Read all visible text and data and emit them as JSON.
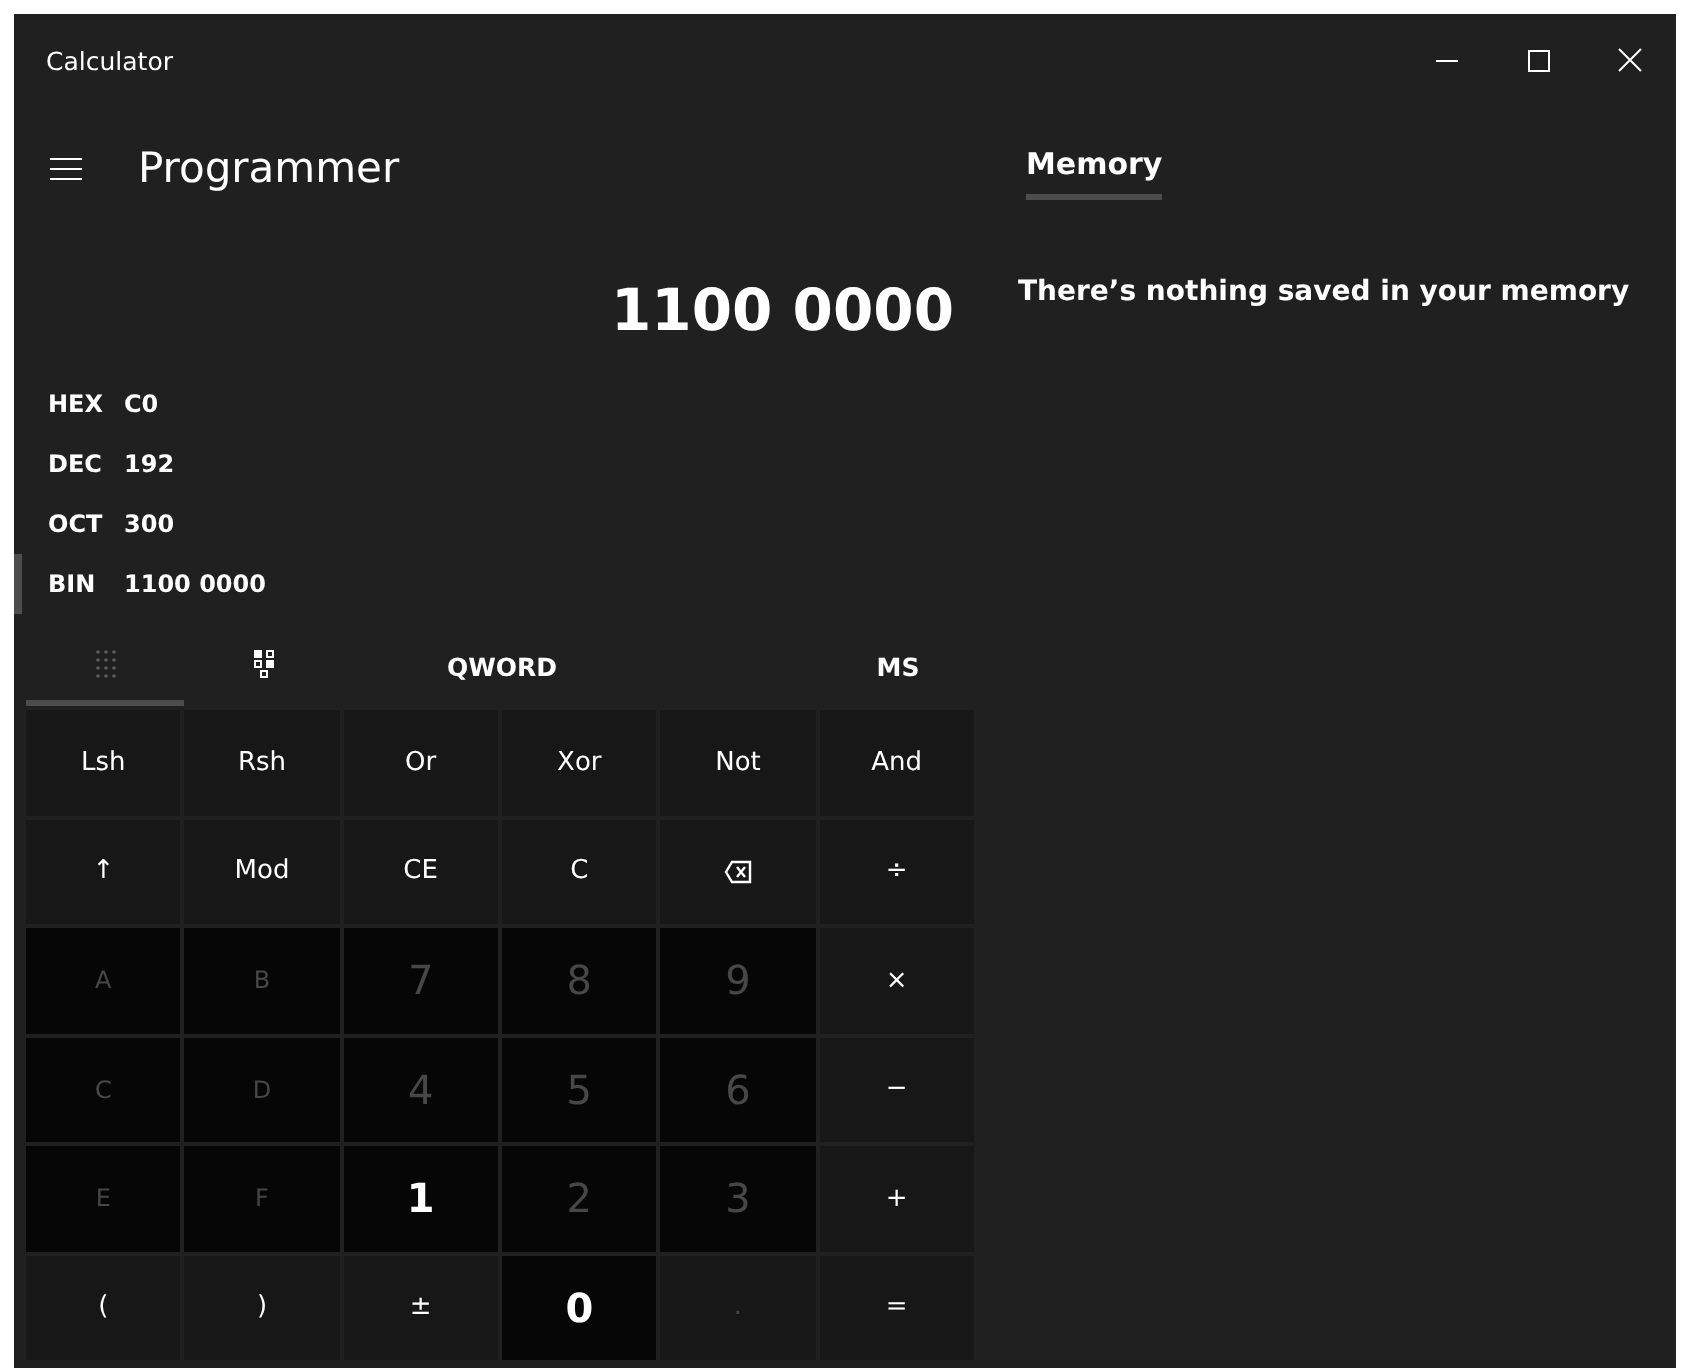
{
  "window": {
    "title": "Calculator"
  },
  "header": {
    "mode": "Programmer"
  },
  "display": {
    "value": "1100 0000"
  },
  "radix": [
    {
      "name": "HEX",
      "value": "C0",
      "selected": false
    },
    {
      "name": "DEC",
      "value": "192",
      "selected": false
    },
    {
      "name": "OCT",
      "value": "300",
      "selected": false
    },
    {
      "name": "BIN",
      "value": "1100 0000",
      "selected": true
    }
  ],
  "keypad_tabs": [
    {
      "kind": "full-keypad",
      "selected": true
    },
    {
      "kind": "bit-toggle",
      "selected": false
    }
  ],
  "word_size": "QWORD",
  "memory_store": "MS",
  "keys": [
    {
      "label": "Lsh",
      "kind": "op",
      "disabled": false
    },
    {
      "label": "Rsh",
      "kind": "op",
      "disabled": false
    },
    {
      "label": "Or",
      "kind": "op",
      "disabled": false
    },
    {
      "label": "Xor",
      "kind": "op",
      "disabled": false
    },
    {
      "label": "Not",
      "kind": "op",
      "disabled": false
    },
    {
      "label": "And",
      "kind": "op",
      "disabled": false
    },
    {
      "label": "↑",
      "kind": "op",
      "disabled": false
    },
    {
      "label": "Mod",
      "kind": "op",
      "disabled": false
    },
    {
      "label": "CE",
      "kind": "op",
      "disabled": false
    },
    {
      "label": "C",
      "kind": "op",
      "disabled": false
    },
    {
      "kind": "backspace",
      "disabled": false
    },
    {
      "label": "÷",
      "kind": "op",
      "disabled": false
    },
    {
      "label": "A",
      "kind": "letter",
      "disabled": true
    },
    {
      "label": "B",
      "kind": "letter",
      "disabled": true
    },
    {
      "label": "7",
      "kind": "digit",
      "disabled": true
    },
    {
      "label": "8",
      "kind": "digit",
      "disabled": true
    },
    {
      "label": "9",
      "kind": "digit",
      "disabled": true
    },
    {
      "label": "×",
      "kind": "op",
      "disabled": false
    },
    {
      "label": "C",
      "kind": "letter",
      "disabled": true
    },
    {
      "label": "D",
      "kind": "letter",
      "disabled": true
    },
    {
      "label": "4",
      "kind": "digit",
      "disabled": true
    },
    {
      "label": "5",
      "kind": "digit",
      "disabled": true
    },
    {
      "label": "6",
      "kind": "digit",
      "disabled": true
    },
    {
      "label": "−",
      "kind": "op",
      "disabled": false
    },
    {
      "label": "E",
      "kind": "letter",
      "disabled": true
    },
    {
      "label": "F",
      "kind": "letter",
      "disabled": true
    },
    {
      "label": "1",
      "kind": "digit",
      "disabled": false
    },
    {
      "label": "2",
      "kind": "digit",
      "disabled": true
    },
    {
      "label": "3",
      "kind": "digit",
      "disabled": true
    },
    {
      "label": "+",
      "kind": "op",
      "disabled": false
    },
    {
      "label": "(",
      "kind": "op",
      "disabled": false
    },
    {
      "label": ")",
      "kind": "op",
      "disabled": false
    },
    {
      "label": "±",
      "kind": "op",
      "disabled": false
    },
    {
      "label": "0",
      "kind": "digit",
      "disabled": false
    },
    {
      "label": ".",
      "kind": "op",
      "disabled": true
    },
    {
      "label": "=",
      "kind": "op",
      "disabled": false
    }
  ],
  "memory": {
    "tab": {
      "label": "Memory",
      "selected": true
    },
    "empty_message": "There’s nothing saved in your memory"
  }
}
